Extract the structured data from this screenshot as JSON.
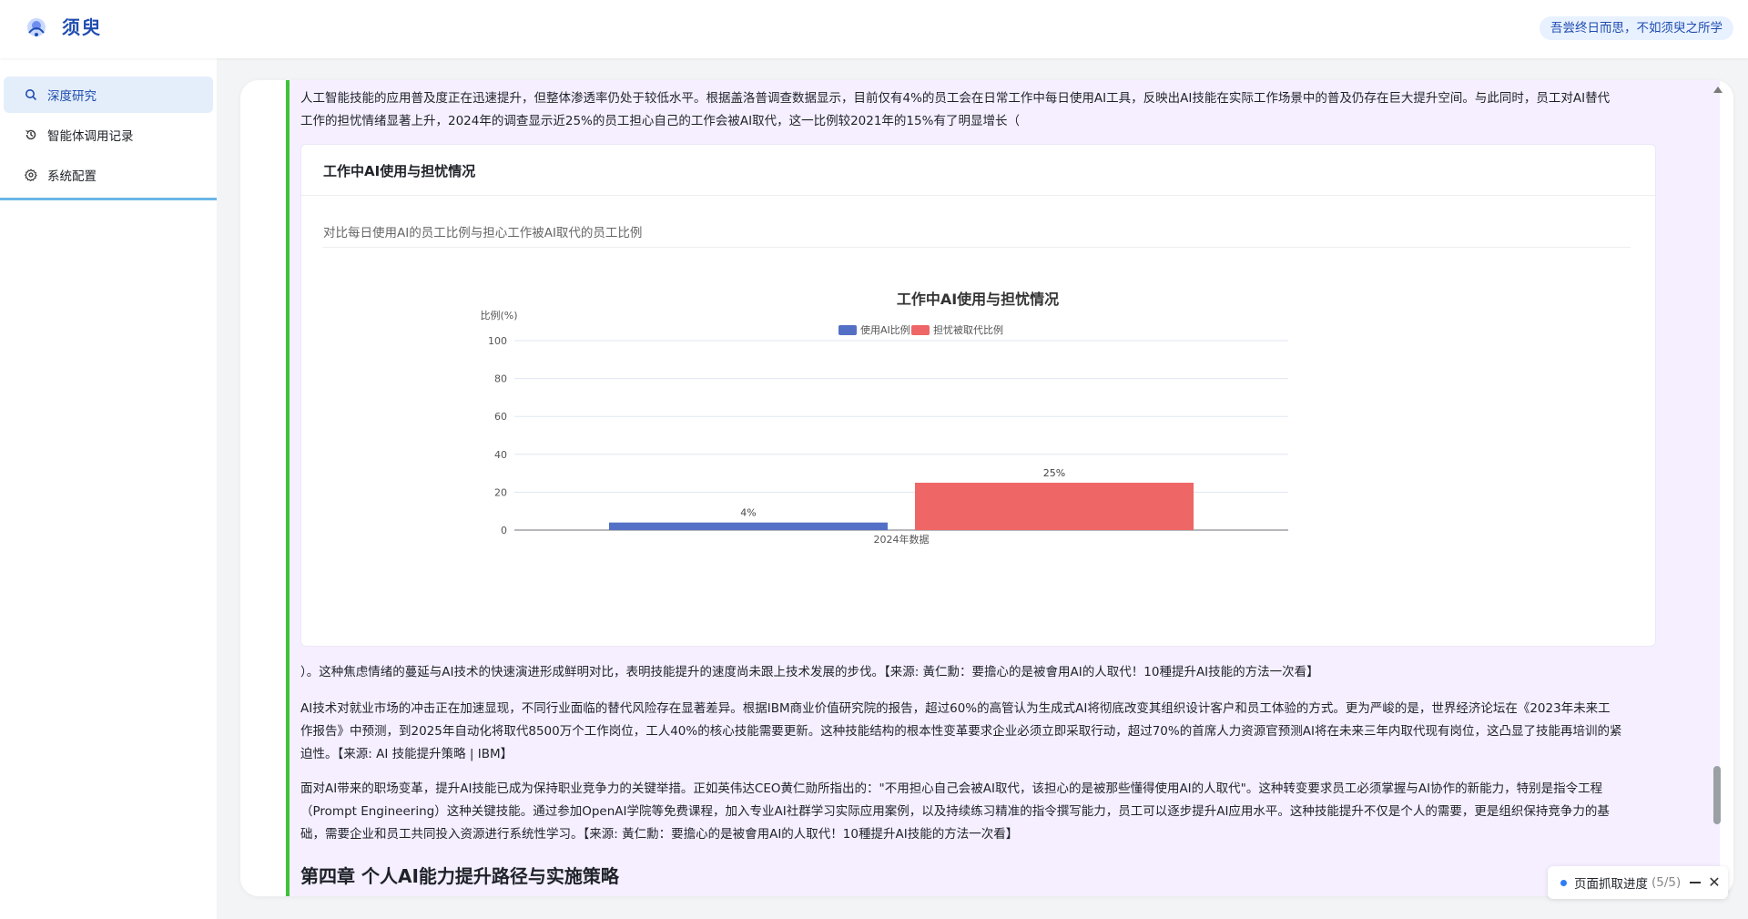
{
  "header": {
    "brand": "须臾",
    "motto": "吾尝终日而思，不如须臾之所学"
  },
  "sidebar": {
    "items": [
      {
        "label": "深度研究",
        "icon": "search-icon",
        "active": true
      },
      {
        "label": "智能体调用记录",
        "icon": "history-icon",
        "active": false
      },
      {
        "label": "系统配置",
        "icon": "gear-icon",
        "active": false
      }
    ]
  },
  "content": {
    "para1_line1": "人工智能技能的应用普及度正在迅速提升，但整体渗透率仍处于较低水平。根据盖洛普调查数据显示，目前仅有4%的员工会在日常工作中每日使用AI工具，反映出AI技能在实际工作场景中的普及仍存在巨大提升空间。与此同时，员工对AI替代",
    "para1_line2": "工作的担忧情绪显著上升，2024年的调查显示近25%的员工担心自己的工作会被AI取代，这一比例较2021年的15%有了明显增长（",
    "chart_card_title": "工作中AI使用与担忧情况",
    "chart_card_desc": "对比每日使用AI的员工比例与担心工作被AI取代的员工比例",
    "para2": "）。这种焦虑情绪的蔓延与AI技术的快速演进形成鲜明对比，表明技能提升的速度尚未跟上技术发展的步伐。【来源: 黃仁勳：要擔心的是被會用AI的人取代！10種提升AI技能的方法一次看】",
    "para3_line1": "AI技术对就业市场的冲击正在加速显现，不同行业面临的替代风险存在显著差异。根据IBM商业价值研究院的报告，超过60%的高管认为生成式AI将彻底改变其组织设计客户和员工体验的方式。更为严峻的是，世界经济论坛在《2023年未来工",
    "para3_line2": "作报告》中预测，到2025年自动化将取代8500万个工作岗位，工人40%的核心技能需要更新。这种技能结构的根本性变革要求企业必须立即采取行动，超过70%的首席人力资源官预测AI将在未来三年内取代现有岗位，这凸显了技能再培训的紧",
    "para3_line3": "迫性。【来源: AI 技能提升策略 | IBM】",
    "para4_line1": "面对AI带来的职场变革，提升AI技能已成为保持职业竞争力的关键举措。正如英伟达CEO黄仁勋所指出的：\"不用担心自己会被AI取代，该担心的是被那些懂得使用AI的人取代\"。这种转变要求员工必须掌握与AI协作的新能力，特别是指令工程",
    "para4_line2": "（Prompt Engineering）这种关键技能。通过参加OpenAI学院等免费课程，加入专业AI社群学习实际应用案例，以及持续练习精准的指令撰写能力，员工可以逐步提升AI应用水平。这种技能提升不仅是个人的需要，更是组织保持竞争力的基",
    "para4_line3": "础，需要企业和员工共同投入资源进行系统性学习。【来源: 黃仁勳：要擔心的是被會用AI的人取代！10種提升AI技能的方法一次看】",
    "chapter_title": "第四章 个人AI能力提升路径与实施策略"
  },
  "chart_data": {
    "type": "bar",
    "title": "工作中AI使用与担忧情况",
    "ylabel": "比例(%)",
    "xlabel": "",
    "categories": [
      "2024年数据"
    ],
    "series": [
      {
        "name": "使用AI比例",
        "values": [
          4
        ],
        "color": "#5470c6",
        "label": "4%"
      },
      {
        "name": "担忧被取代比例",
        "values": [
          25
        ],
        "color": "#ee6666",
        "label": "25%"
      }
    ],
    "ylim": [
      0,
      100
    ],
    "yticks": [
      "0",
      "20",
      "40",
      "60",
      "80",
      "100"
    ],
    "grid": true,
    "legend": "top-center"
  },
  "progress": {
    "label": "页面抓取进度",
    "count": "(5/5)"
  }
}
